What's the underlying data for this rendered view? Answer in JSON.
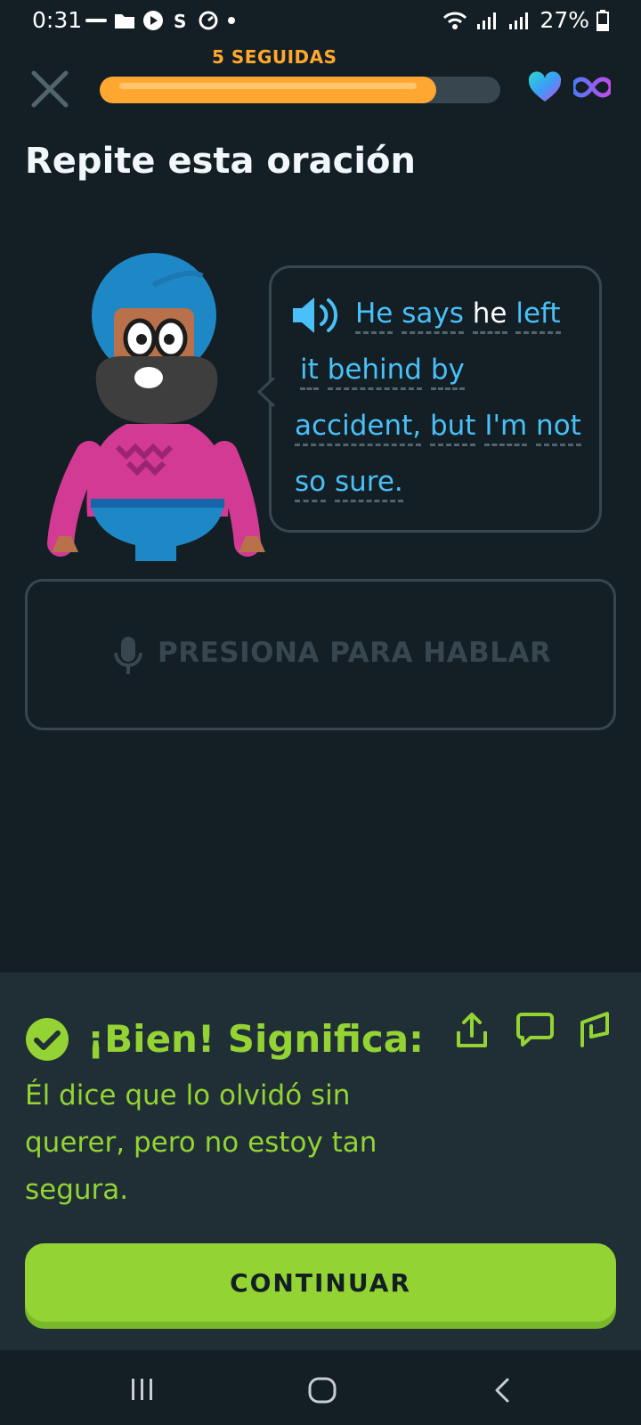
{
  "status_bar": {
    "time": "0:31",
    "battery": "27%"
  },
  "header": {
    "streak_label": "5 SEGUIDAS",
    "progress_fraction": 0.84,
    "hearts": "infinite"
  },
  "exercise": {
    "title": "Repite esta oración",
    "words": [
      "He",
      "says",
      "he",
      "left",
      "it",
      "behind",
      "by",
      "accident,",
      "but",
      "I'm",
      "not",
      "so",
      "sure."
    ],
    "highlighted_word": "he"
  },
  "speak_button": {
    "label": "PRESIONA PARA HABLAR"
  },
  "feedback": {
    "title": "¡Bien! Significa:",
    "translation": "Él dice que lo olvidó sin querer, pero no estoy tan segura."
  },
  "continue_button": {
    "label": "CONTINUAR"
  },
  "colors": {
    "background": "#131F24",
    "streak": "#FFA82E",
    "progress": "#FFA731",
    "sentence": "#49C0F8",
    "correct": "#93D333"
  },
  "icons": [
    "close-icon",
    "heart-icon",
    "infinity-icon",
    "speaker-icon",
    "microphone-icon",
    "check-icon",
    "share-icon",
    "comment-icon",
    "flag-icon"
  ]
}
